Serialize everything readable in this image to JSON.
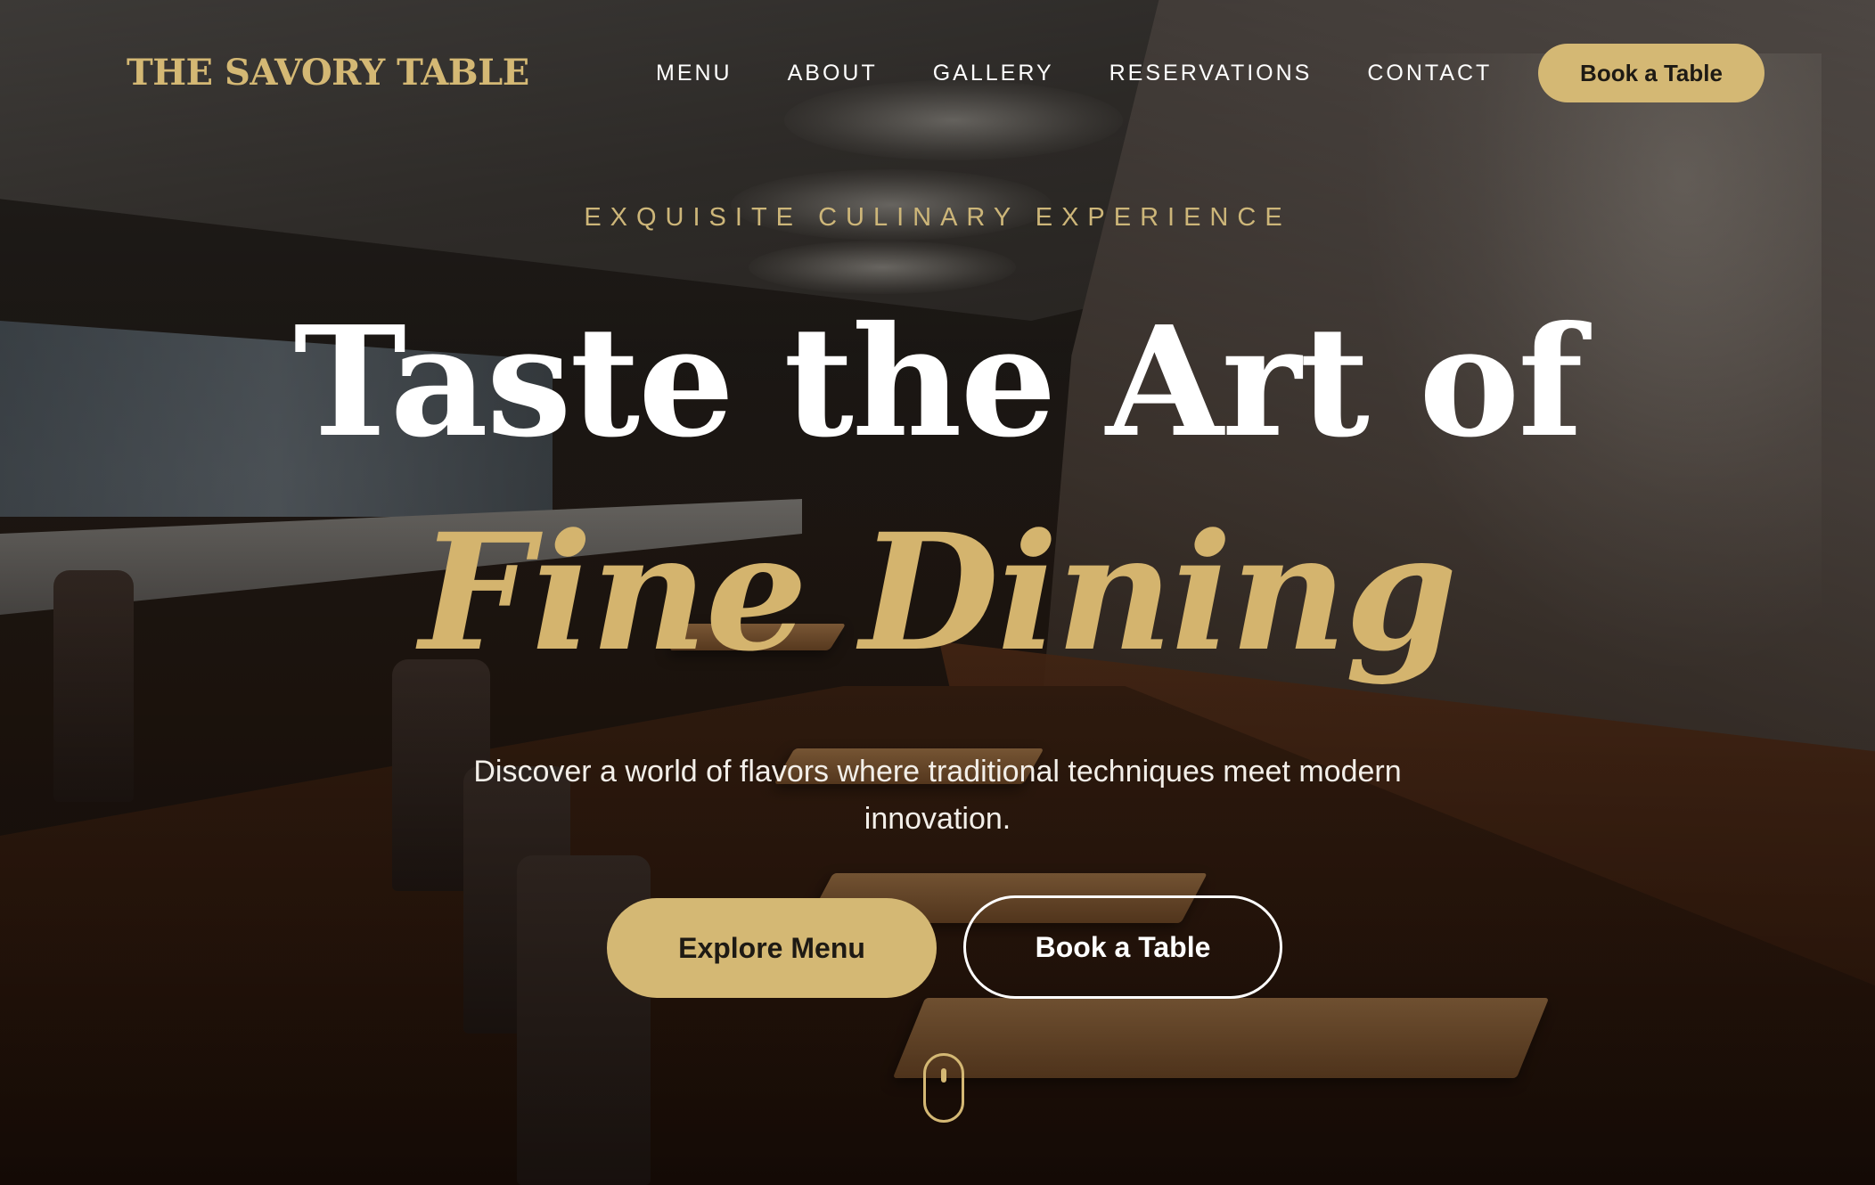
{
  "brand": {
    "logo_text": "THE SAVORY TABLE",
    "accent_color": "#d4b874"
  },
  "nav": {
    "items": [
      {
        "label": "MENU"
      },
      {
        "label": "ABOUT"
      },
      {
        "label": "GALLERY"
      },
      {
        "label": "RESERVATIONS"
      },
      {
        "label": "CONTACT"
      }
    ],
    "cta_label": "Book a Table"
  },
  "hero": {
    "eyebrow": "EXQUISITE CULINARY EXPERIENCE",
    "headline_line1": "Taste the Art of",
    "headline_line2": "Fine Dining",
    "subtitle": "Discover a world of flavors where traditional techniques meet modern innovation.",
    "primary_button": "Explore Menu",
    "secondary_button": "Book a Table",
    "scroll_icon": "mouse-scroll-icon"
  }
}
